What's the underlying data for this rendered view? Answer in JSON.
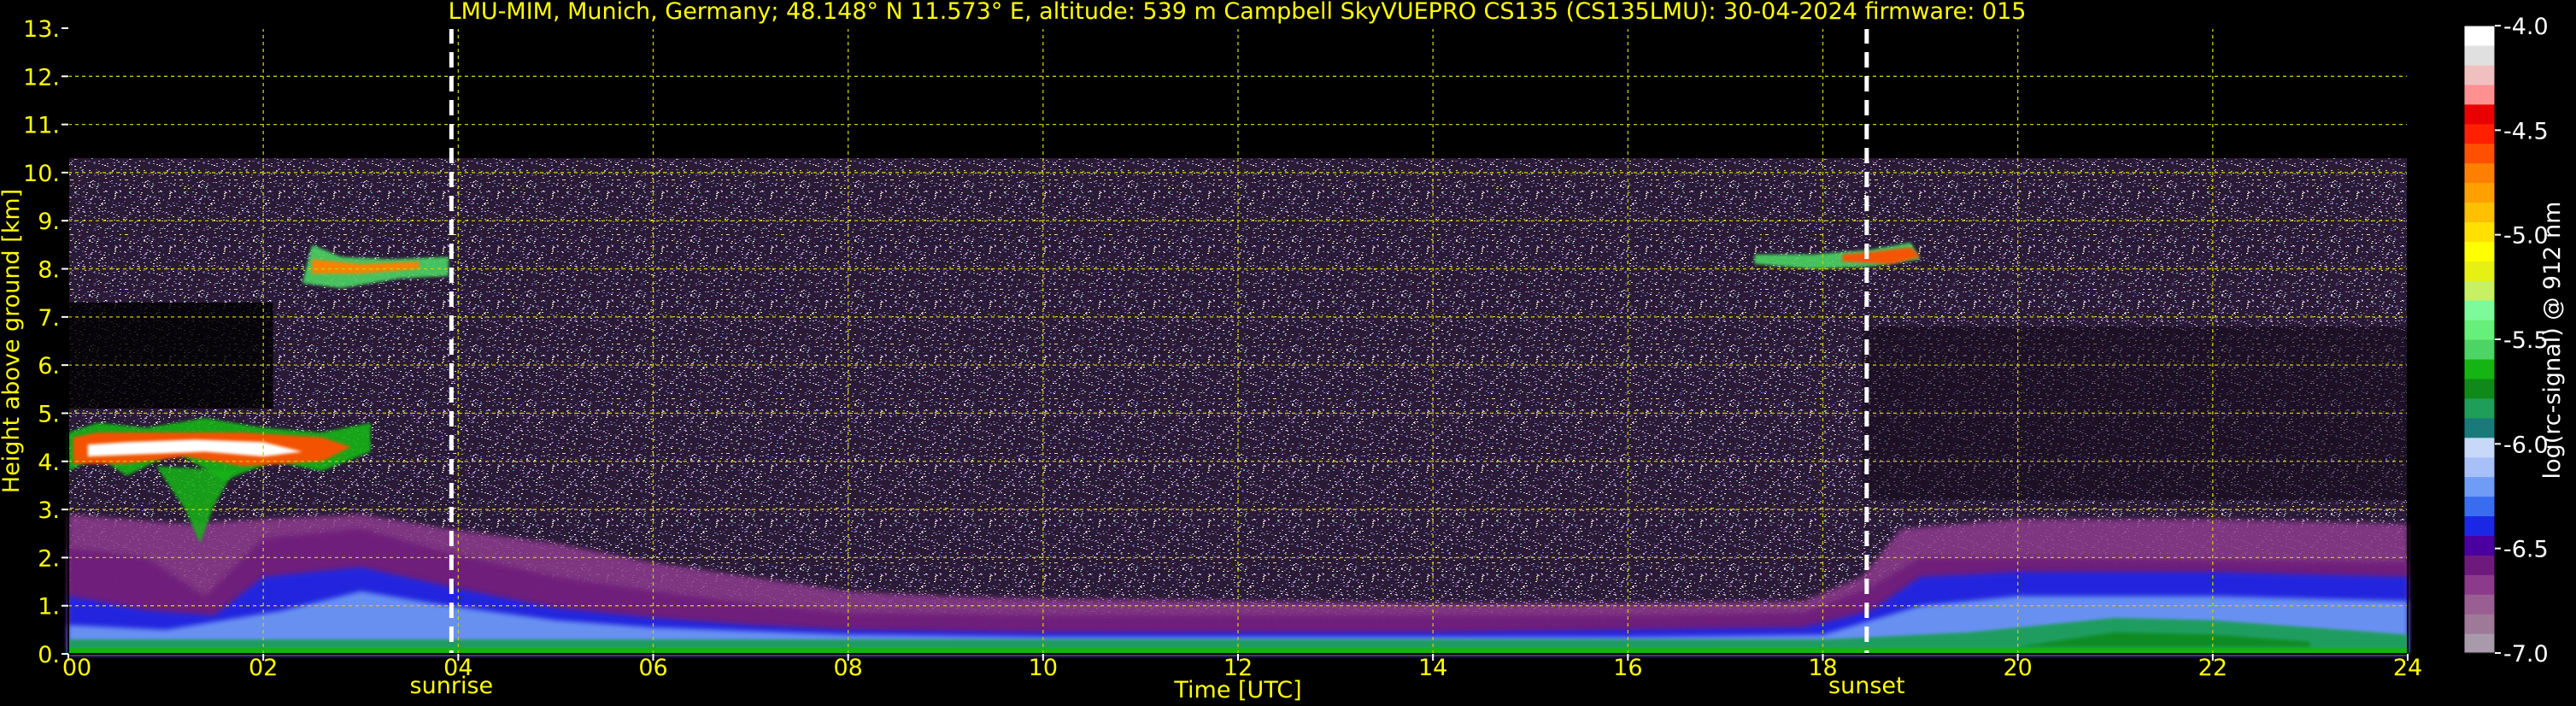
{
  "chart_data": {
    "type": "heatmap",
    "title": "LMU-MIM, Munich, Germany; 48.148° N 11.573° E, altitude: 539 m    Campbell SkyVUEPRO CS135 (CS135LMU): 30-04-2024    firmware: 015",
    "xlabel": "Time [UTC]",
    "ylabel": "Height above ground [km]",
    "xlim": [
      0,
      24
    ],
    "ylim": [
      0,
      13
    ],
    "x_ticks": [
      "00",
      "02",
      "04",
      "06",
      "08",
      "10",
      "12",
      "14",
      "16",
      "18",
      "20",
      "22",
      "24"
    ],
    "x_tick_values": [
      0,
      2,
      4,
      6,
      8,
      10,
      12,
      14,
      16,
      18,
      20,
      22,
      24
    ],
    "y_ticks": [
      "0.",
      "1.",
      "2.",
      "3.",
      "4.",
      "5.",
      "6.",
      "7.",
      "8.",
      "9.",
      "10.",
      "11.",
      "12.",
      "13."
    ],
    "y_tick_values": [
      0,
      1,
      2,
      3,
      4,
      5,
      6,
      7,
      8,
      9,
      10,
      11,
      12,
      13
    ],
    "grid": true,
    "data_ceiling_km": 10.3,
    "events": [
      {
        "label": "sunrise",
        "time": 3.93
      },
      {
        "label": "sunset",
        "time": 18.45
      }
    ],
    "colorbar": {
      "label": "log(rc-signal) @ 912 nm",
      "min": -7.0,
      "max": -4.0,
      "ticks": [
        "-4.0",
        "-4.5",
        "-5.0",
        "-5.5",
        "-6.0",
        "-6.5",
        "-7.0"
      ],
      "tick_values": [
        -4.0,
        -4.5,
        -5.0,
        -5.5,
        -6.0,
        -6.5,
        -7.0
      ],
      "colors": [
        "#a89aaa",
        "#9e7a98",
        "#9a5f92",
        "#8c3a8c",
        "#6e1a7c",
        "#4a00a0",
        "#1a28e6",
        "#3a6cf0",
        "#6f9cf4",
        "#a8c0f8",
        "#c8d8f8",
        "#1a7a7a",
        "#1f9e5a",
        "#0f8a1a",
        "#14b414",
        "#4cd464",
        "#64f07a",
        "#7dfa9a",
        "#c8f064",
        "#e6f014",
        "#ffff00",
        "#ffe000",
        "#ffc000",
        "#ffa000",
        "#ff8000",
        "#ff5000",
        "#ff2000",
        "#e80000",
        "#ff9090",
        "#f0c0c0",
        "#e0e0e0",
        "#ffffff"
      ]
    },
    "layers": [
      {
        "name": "boundary layer (daytime)",
        "t_start": 0,
        "t_end": 24,
        "height_km": [
          0.1,
          0.8
        ]
      },
      {
        "name": "cloud layer",
        "t_start": 0,
        "t_end": 3.1,
        "height_km": [
          3.7,
          4.8
        ]
      },
      {
        "name": "high cloud",
        "t_start": 2.4,
        "t_end": 3.9,
        "height_km": [
          7.7,
          8.4
        ]
      },
      {
        "name": "high cloud",
        "t_start": 17.3,
        "t_end": 19.0,
        "height_km": [
          8.0,
          8.5
        ]
      }
    ]
  }
}
